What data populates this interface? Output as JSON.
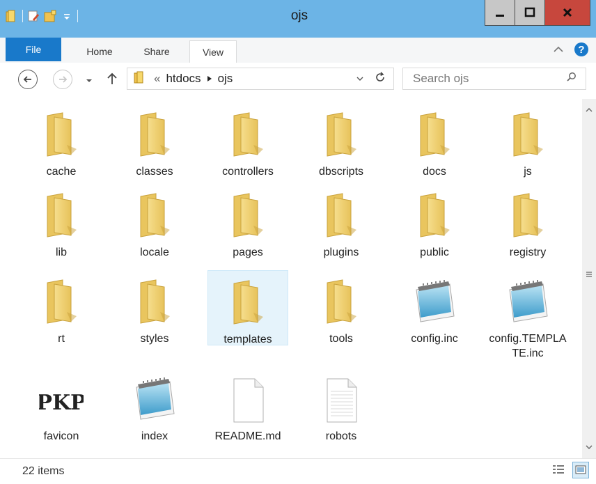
{
  "window": {
    "title": "ojs"
  },
  "ribbon": {
    "tabs": {
      "file": "File",
      "home": "Home",
      "share": "Share",
      "view": "View"
    }
  },
  "address": {
    "overflow": "«",
    "segments": [
      "htdocs",
      "ojs"
    ]
  },
  "search": {
    "placeholder": "Search ojs"
  },
  "items": [
    {
      "label": "cache",
      "type": "folder"
    },
    {
      "label": "classes",
      "type": "folder"
    },
    {
      "label": "controllers",
      "type": "folder"
    },
    {
      "label": "dbscripts",
      "type": "folder"
    },
    {
      "label": "docs",
      "type": "folder"
    },
    {
      "label": "js",
      "type": "folder"
    },
    {
      "label": "lib",
      "type": "folder"
    },
    {
      "label": "locale",
      "type": "folder"
    },
    {
      "label": "pages",
      "type": "folder"
    },
    {
      "label": "plugins",
      "type": "folder"
    },
    {
      "label": "public",
      "type": "folder"
    },
    {
      "label": "registry",
      "type": "folder"
    },
    {
      "label": "rt",
      "type": "folder"
    },
    {
      "label": "styles",
      "type": "folder"
    },
    {
      "label": "templates",
      "type": "folder",
      "selected": true
    },
    {
      "label": "tools",
      "type": "folder"
    },
    {
      "label": "config.inc",
      "type": "notepad"
    },
    {
      "label": "config.TEMPLATE.inc",
      "type": "notepad"
    },
    {
      "label": "favicon",
      "type": "pkp",
      "icon_text": "PKP"
    },
    {
      "label": "index",
      "type": "notepad"
    },
    {
      "label": "README.md",
      "type": "blank"
    },
    {
      "label": "robots",
      "type": "text"
    }
  ],
  "status": {
    "count": "22 items"
  },
  "colors": {
    "titlebar": "#6cb4e6",
    "file_tab": "#1979ca",
    "close": "#c7473d",
    "folder": "#f3d57a",
    "selected": "#e5f3fb"
  }
}
